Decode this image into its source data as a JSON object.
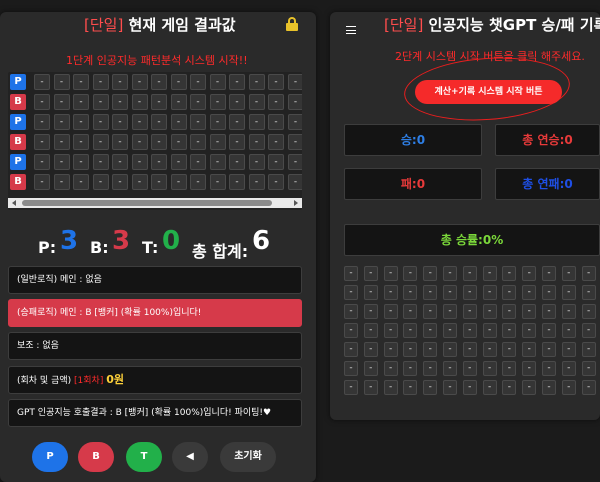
{
  "left": {
    "title_tag": "[단일]",
    "title": " 현재 게임 결과값",
    "subtitle": "1단계  인공지능 패턴분석 시스템 시작!!",
    "grid": {
      "row_labels": [
        "P",
        "B",
        "P",
        "B",
        "P",
        "B"
      ],
      "empty_cell": "-"
    },
    "stats": {
      "p_label": "P:",
      "p_value": "3",
      "b_label": "B:",
      "b_value": "3",
      "t_label": "T:",
      "t_value": "0",
      "total_label": "총 합계:",
      "total_value": "6"
    },
    "info": {
      "general_main": "(일반로직) 메인 : 없음",
      "win_main": "(승패로직) 메인 : B [뱅커] (확률 100%)입니다!",
      "sub": "보조 : 없음",
      "round_prefix": "(회차 및 금액) ",
      "round_value": "[1회차]",
      "amount": "0원",
      "gpt_result": "GPT 인공지능 호출결과 : B [뱅커] (확률 100%)입니다! 파이팅!♥"
    },
    "buttons": {
      "p": "P",
      "b": "B",
      "t": "T",
      "back": "◀",
      "reset": "초기화"
    }
  },
  "right": {
    "title_tag": "[단일]",
    "title": " 인공지능 챗GPT 승/패 기록",
    "subtitle": "2단계  시스템 시작 버튼을 클릭 해주세요.",
    "start_button": "계산+기록 시스템 시작 버튼",
    "win": "승:0",
    "win_streak": "총 연승:0",
    "loss": "패:0",
    "loss_streak": "총 연패:0",
    "win_rate": "총 승률:0%",
    "empty_cell": "-"
  },
  "colors": {
    "player": "#1e73e8",
    "banker": "#d63a4a",
    "tie": "#22b04a",
    "accent_red": "#ff2b2b",
    "win_rate": "#7bd83a"
  }
}
